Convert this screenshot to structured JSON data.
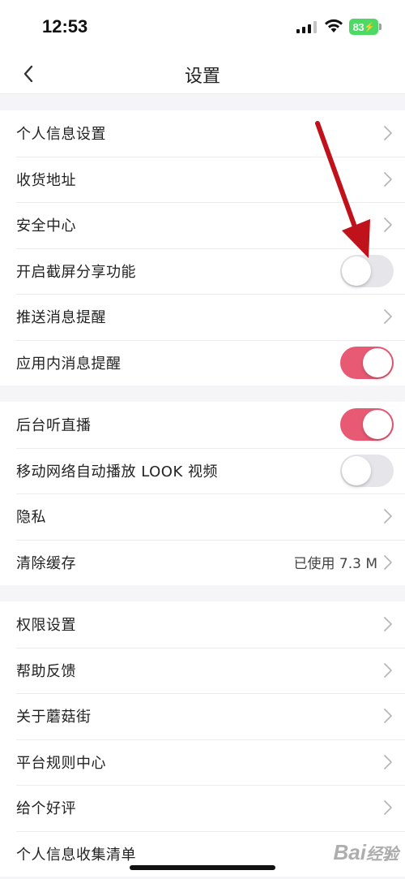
{
  "status_bar": {
    "time": "12:53",
    "battery": "83"
  },
  "nav": {
    "title": "设置"
  },
  "groups": [
    {
      "rows": [
        {
          "label": "个人信息设置",
          "type": "link"
        },
        {
          "label": "收货地址",
          "type": "link"
        },
        {
          "label": "安全中心",
          "type": "link"
        },
        {
          "label": "开启截屏分享功能",
          "type": "toggle",
          "on": false
        },
        {
          "label": "推送消息提醒",
          "type": "link"
        },
        {
          "label": "应用内消息提醒",
          "type": "toggle",
          "on": true
        }
      ]
    },
    {
      "rows": [
        {
          "label": "后台听直播",
          "type": "toggle",
          "on": true
        },
        {
          "label": "移动网络自动播放 LOOK 视频",
          "type": "toggle",
          "on": false
        },
        {
          "label": "隐私",
          "type": "link"
        },
        {
          "label": "清除缓存",
          "type": "link",
          "value": "已使用 7.3 M"
        }
      ]
    },
    {
      "rows": [
        {
          "label": "权限设置",
          "type": "link"
        },
        {
          "label": "帮助反馈",
          "type": "link"
        },
        {
          "label": "关于蘑菇街",
          "type": "link"
        },
        {
          "label": "平台规则中心",
          "type": "link"
        },
        {
          "label": "给个好评",
          "type": "link"
        },
        {
          "label": "个人信息收集清单",
          "type": "link"
        }
      ]
    }
  ],
  "colors": {
    "toggle_on": "#e85a74",
    "toggle_off": "#e5e5ea",
    "annotation_arrow": "#c0121a"
  },
  "watermark": "Bai经验"
}
